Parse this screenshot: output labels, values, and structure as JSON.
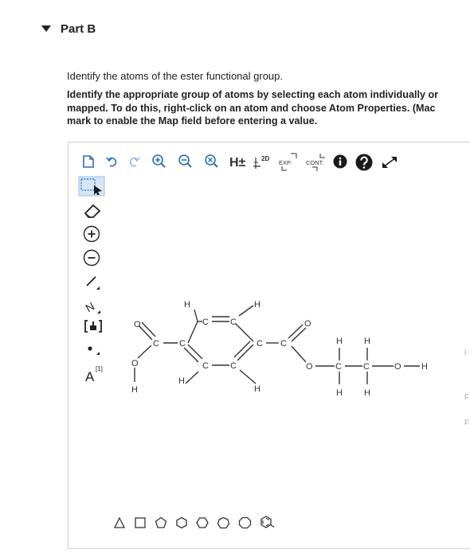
{
  "part": {
    "title": "Part B"
  },
  "question": "Identify the atoms of the ester functional group.",
  "instructions": [
    "Identify the appropriate group of atoms by selecting each atom individually or",
    "mapped. To do this, right-click on an atom and choose Atom Properties. (Mac",
    "mark to enable the Map field before entering a value."
  ],
  "toolbar": {
    "icons": [
      "new-document-icon",
      "undo-icon",
      "redo-icon",
      "zoom-in-icon",
      "zoom-out-icon",
      "clear-icon",
      "hydrogen-toggle-icon",
      "2d-clean-icon",
      "expand-icon",
      "contract-icon",
      "info-icon",
      "help-icon",
      "fullscreen-icon"
    ],
    "hydrogen_label": "H±",
    "clean_label": "2D",
    "expand_label": "EXP.",
    "contract_label": "CONT."
  },
  "sidebar": {
    "tools": [
      "selection-tool-icon",
      "eraser-icon",
      "positive-charge-icon",
      "negative-charge-icon",
      "single-bond-icon",
      "chain-icon",
      "bracket-icon",
      "electron-dot-icon",
      "atom-map-icon"
    ],
    "chain_label": "N",
    "atom_label": "A",
    "atom_superscript": "[1]"
  },
  "molecule": {
    "atoms": [
      {
        "id": "o1",
        "label": "O"
      },
      {
        "id": "o2",
        "label": "O"
      },
      {
        "id": "h_oh",
        "label": "H"
      },
      {
        "id": "c1",
        "label": "C"
      },
      {
        "id": "c2",
        "label": "C"
      },
      {
        "id": "h_c2",
        "label": "H"
      },
      {
        "id": "h_top1",
        "label": "H"
      },
      {
        "id": "c3",
        "label": "C"
      },
      {
        "id": "c4",
        "label": "C"
      },
      {
        "id": "h_top2",
        "label": "H"
      },
      {
        "id": "c5",
        "label": "C"
      },
      {
        "id": "c6",
        "label": "C"
      },
      {
        "id": "h_c6",
        "label": "H"
      },
      {
        "id": "c7",
        "label": "C"
      },
      {
        "id": "c8",
        "label": "C"
      },
      {
        "id": "o3",
        "label": "O"
      },
      {
        "id": "o4",
        "label": "O"
      },
      {
        "id": "c9",
        "label": "C"
      },
      {
        "id": "c10",
        "label": "C"
      },
      {
        "id": "o5",
        "label": "O"
      },
      {
        "id": "h_oh2",
        "label": "H"
      },
      {
        "id": "h_c9_up",
        "label": "H"
      },
      {
        "id": "h_c10_up",
        "label": "H"
      },
      {
        "id": "h_c9_down",
        "label": "H"
      },
      {
        "id": "h_c10_down",
        "label": "H"
      }
    ]
  },
  "bottom_toolbar": {
    "icons": [
      "triangle-icon",
      "square-icon",
      "pentagon-icon",
      "hexagon-icon",
      "hexagon-alt-icon",
      "heptagon-icon",
      "octagon-icon",
      "benzene-icon"
    ]
  },
  "right_edge_labels": [
    "I",
    "F",
    "F"
  ]
}
